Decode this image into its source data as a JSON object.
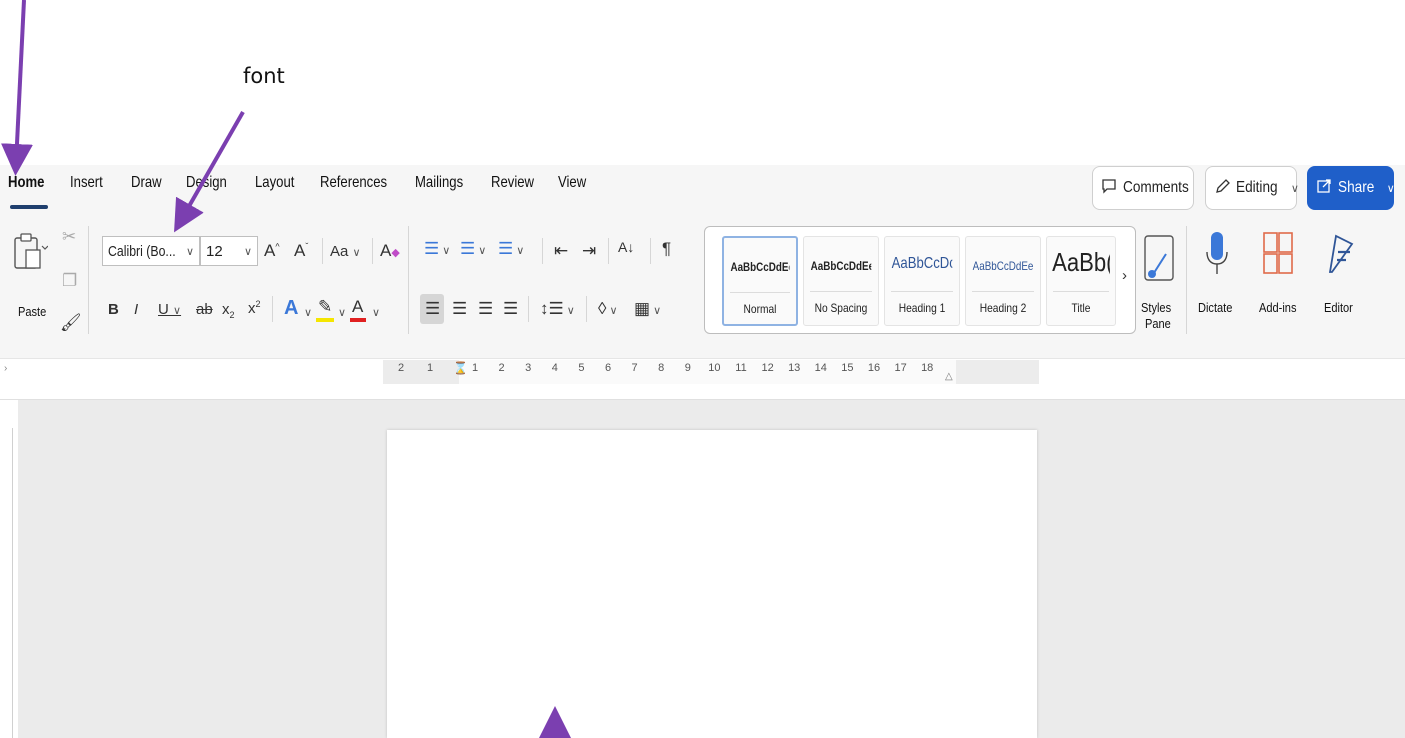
{
  "annotations": {
    "font_label": "font"
  },
  "tabs": [
    "Home",
    "Insert",
    "Draw",
    "Design",
    "Layout",
    "References",
    "Mailings",
    "Review",
    "View"
  ],
  "actions": {
    "comments": "Comments",
    "editing": "Editing",
    "share": "Share"
  },
  "clipboard": {
    "paste": "Paste"
  },
  "font": {
    "family": "Calibri (Bo...",
    "size": "12",
    "change_case": "Aa"
  },
  "styles": [
    {
      "sample": "AaBbCcDdEe",
      "name": "Normal"
    },
    {
      "sample": "AaBbCcDdEe",
      "name": "No Spacing"
    },
    {
      "sample": "AaBbCcDc",
      "name": "Heading 1"
    },
    {
      "sample": "AaBbCcDdEe",
      "name": "Heading 2"
    },
    {
      "sample": "AaBb(",
      "name": "Title"
    }
  ],
  "right_group": {
    "styles_pane_line1": "Styles",
    "styles_pane_line2": "Pane",
    "dictate": "Dictate",
    "addins": "Add-ins",
    "editor": "Editor"
  },
  "ruler": {
    "left_numbers": [
      "2",
      "1"
    ],
    "numbers": [
      "1",
      "2",
      "3",
      "4",
      "5",
      "6",
      "7",
      "8",
      "9",
      "10",
      "11",
      "12",
      "13",
      "14",
      "15",
      "16",
      "17",
      "18"
    ]
  },
  "colors": {
    "accent": "#1f5fc9",
    "arrow": "#7b3fb0",
    "tab_underline": "#1f3f6e",
    "highlight_yellow": "#f5e600",
    "font_red": "#e02020",
    "addins": "#e06a4a",
    "dictate_blue": "#3b78d8"
  }
}
